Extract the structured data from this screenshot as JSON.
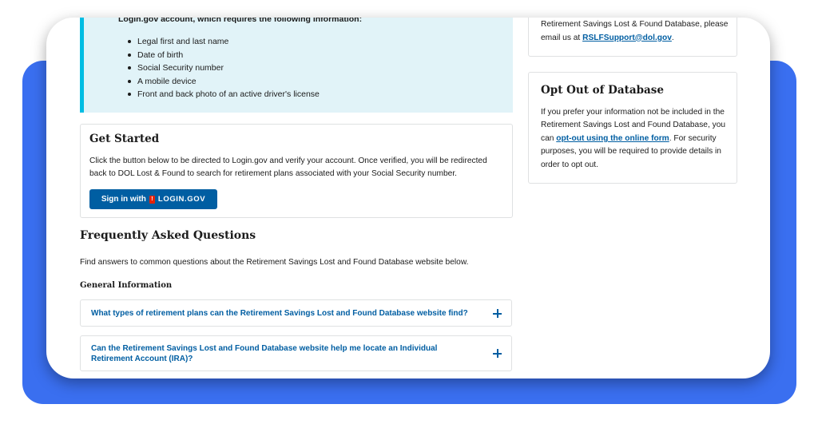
{
  "requirements": {
    "intro": "Login.gov account, which requires the following information:",
    "items": [
      "Legal first and last name",
      "Date of birth",
      "Social Security number",
      "A mobile device",
      "Front and back photo of an active driver's license"
    ]
  },
  "get_started": {
    "title": "Get Started",
    "description": "Click the button below to be directed to Login.gov and verify your account. Once verified, you will be redirected back to DOL Lost & Found to search for retirement plans associated with your Social Security number.",
    "button_prefix": "Sign in with",
    "button_badge": "!",
    "button_brand": "LOGIN.GOV"
  },
  "faq": {
    "title": "Frequently Asked Questions",
    "intro": "Find answers to common questions about the Retirement Savings Lost and Found Database website below.",
    "section_label": "General Information",
    "questions": [
      "What types of retirement plans can the Retirement Savings Lost and Found Database website find?",
      "Can the Retirement Savings Lost and Found Database website help me locate an Individual Retirement Account (IRA)?"
    ]
  },
  "contact": {
    "text_before": "Retirement Savings Lost & Found Database, please email us at ",
    "email": "RSLFSupport@dol.gov",
    "text_after": "."
  },
  "opt_out": {
    "title": "Opt Out of Database",
    "text_before": "If you prefer your information not be included in the Retirement Savings Lost and Found Database, you can ",
    "link": "opt-out using the online form",
    "text_after": ". For security purposes, you will be required to provide details in order to opt out."
  },
  "colors": {
    "backdrop": "#3a6ff0",
    "primary": "#005ea2",
    "alert_bg": "#e1f3f8",
    "alert_border": "#00bde3"
  }
}
